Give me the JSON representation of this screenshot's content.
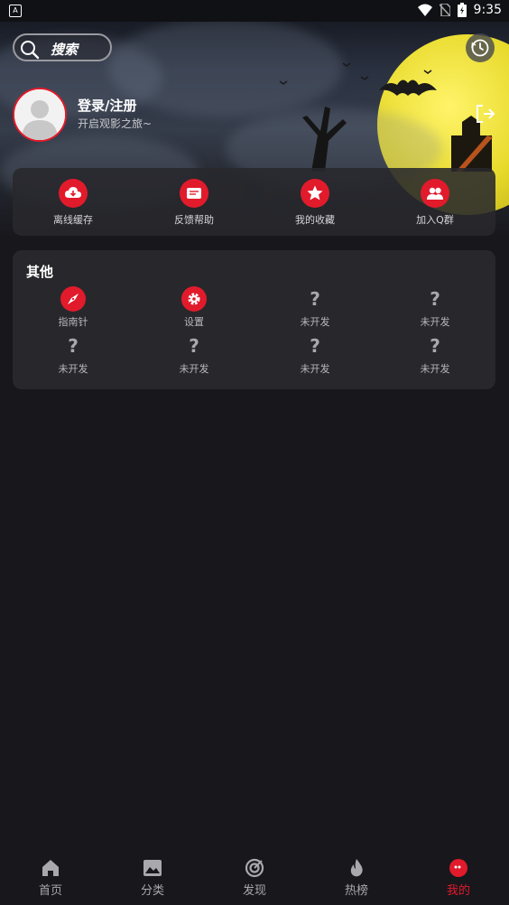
{
  "status_bar": {
    "time": "9:35",
    "notification_icon": "a-icon"
  },
  "header": {
    "search_placeholder": "搜索",
    "history_icon": "clock-history-icon"
  },
  "profile": {
    "title": "登录/注册",
    "subtitle": "开启观影之旅~",
    "logout_icon": "logout-icon"
  },
  "quick_actions": [
    {
      "label": "离线缓存",
      "icon": "cloud-download-icon"
    },
    {
      "label": "反馈帮助",
      "icon": "feedback-icon"
    },
    {
      "label": "我的收藏",
      "icon": "star-icon"
    },
    {
      "label": "加入Q群",
      "icon": "group-icon"
    }
  ],
  "other": {
    "title": "其他",
    "items": [
      {
        "label": "指南针",
        "icon": "compass-icon"
      },
      {
        "label": "设置",
        "icon": "gear-icon"
      },
      {
        "label": "未开发",
        "icon": "question-icon"
      },
      {
        "label": "未开发",
        "icon": "question-icon"
      },
      {
        "label": "未开发",
        "icon": "question-icon"
      },
      {
        "label": "未开发",
        "icon": "question-icon"
      },
      {
        "label": "未开发",
        "icon": "question-icon"
      },
      {
        "label": "未开发",
        "icon": "question-icon"
      }
    ]
  },
  "nav": {
    "items": [
      {
        "label": "首页",
        "icon": "home-icon"
      },
      {
        "label": "分类",
        "icon": "image-icon"
      },
      {
        "label": "发现",
        "icon": "target-icon"
      },
      {
        "label": "热榜",
        "icon": "flame-icon"
      },
      {
        "label": "我的",
        "icon": "ghost-icon"
      }
    ],
    "active_index": 4
  },
  "colors": {
    "accent": "#e11b2b",
    "background": "#18171c",
    "card": "#28282c"
  }
}
